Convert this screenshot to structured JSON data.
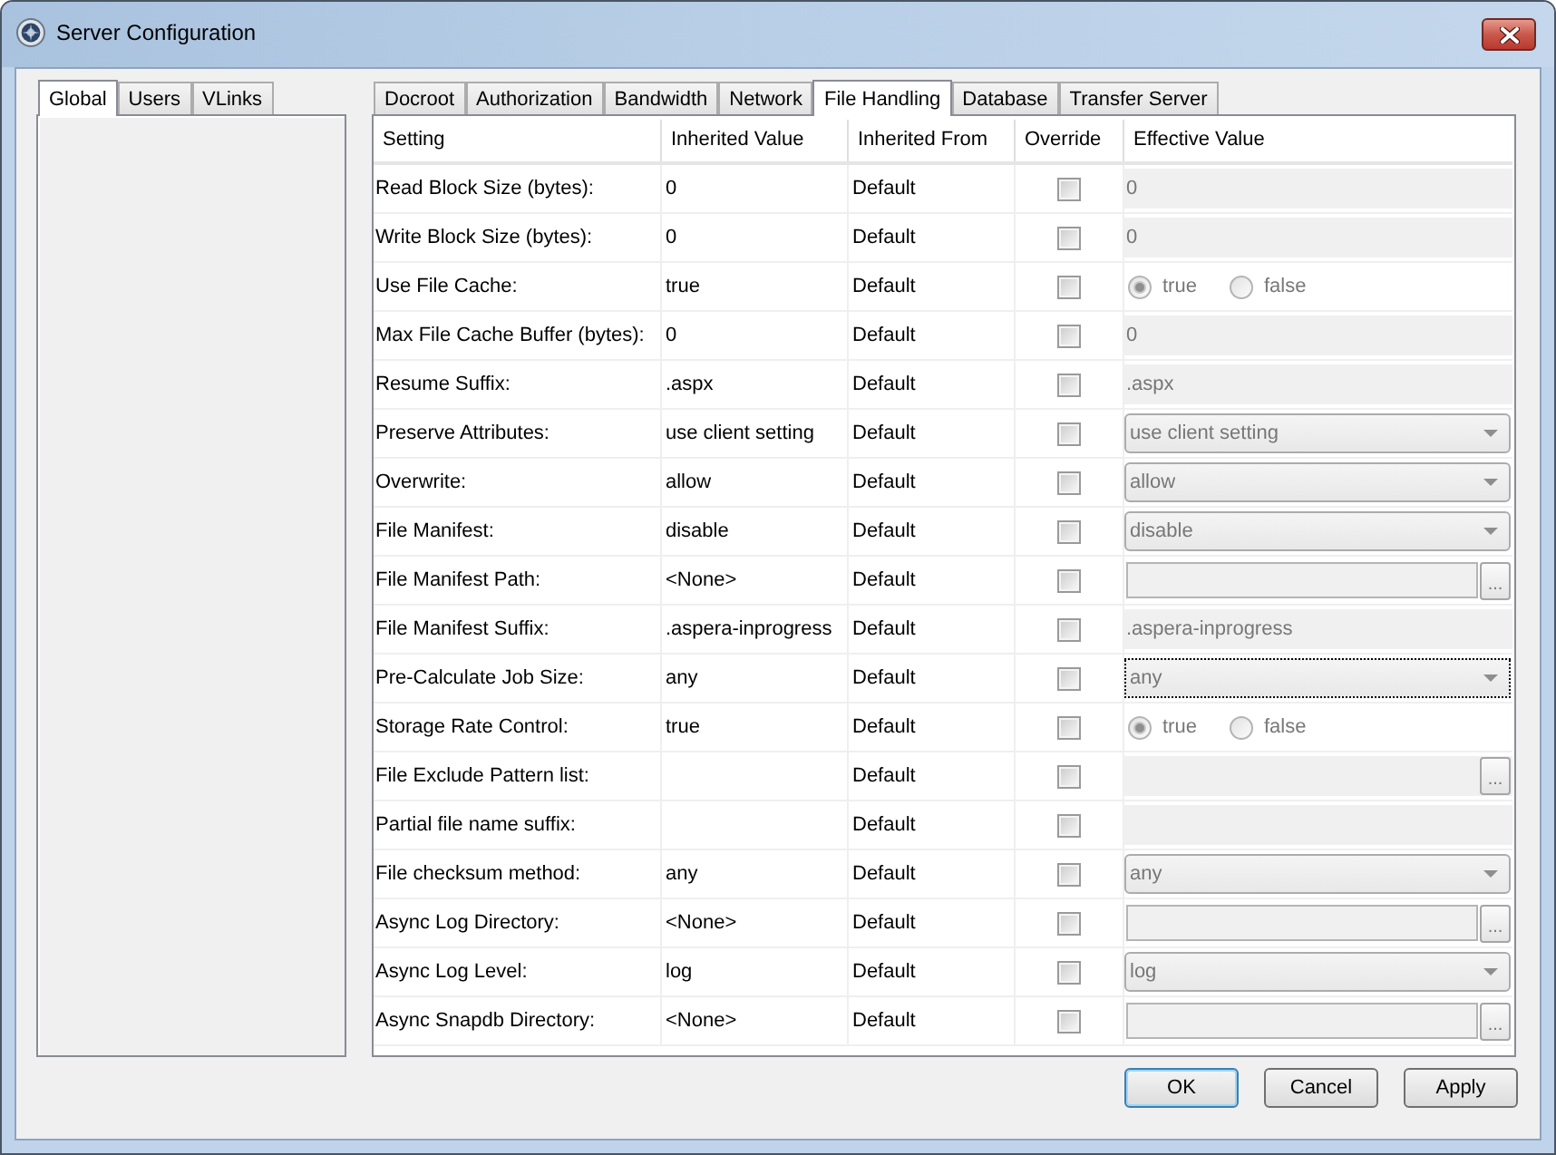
{
  "window": {
    "title": "Server Configuration"
  },
  "left_panel": {
    "tabs": [
      {
        "label": "Global",
        "selected": true
      },
      {
        "label": "Users",
        "selected": false
      },
      {
        "label": "VLinks",
        "selected": false
      }
    ]
  },
  "right_panel": {
    "tabs": [
      {
        "label": "Docroot",
        "selected": false
      },
      {
        "label": "Authorization",
        "selected": false
      },
      {
        "label": "Bandwidth",
        "selected": false
      },
      {
        "label": "Network",
        "selected": false
      },
      {
        "label": "File Handling",
        "selected": true
      },
      {
        "label": "Database",
        "selected": false
      },
      {
        "label": "Transfer Server",
        "selected": false
      }
    ],
    "table": {
      "columns": [
        "Setting",
        "Inherited Value",
        "Inherited From",
        "Override",
        "Effective Value"
      ],
      "rows": [
        {
          "setting": "Read Block Size (bytes):",
          "inherited_value": "0",
          "inherited_from": "Default",
          "override_checked": false,
          "effective": {
            "kind": "text",
            "value": "0",
            "focused": false
          }
        },
        {
          "setting": "Write Block Size (bytes):",
          "inherited_value": "0",
          "inherited_from": "Default",
          "override_checked": false,
          "effective": {
            "kind": "text",
            "value": "0",
            "focused": false
          }
        },
        {
          "setting": "Use File Cache:",
          "inherited_value": "true",
          "inherited_from": "Default",
          "override_checked": false,
          "effective": {
            "kind": "radio",
            "focused": false,
            "options": [
              {
                "label": "true",
                "selected": true
              },
              {
                "label": "false",
                "selected": false
              }
            ]
          }
        },
        {
          "setting": "Max File Cache Buffer (bytes):",
          "inherited_value": "0",
          "inherited_from": "Default",
          "override_checked": false,
          "effective": {
            "kind": "text",
            "value": "0",
            "focused": false
          }
        },
        {
          "setting": "Resume Suffix:",
          "inherited_value": ".aspx",
          "inherited_from": "Default",
          "override_checked": false,
          "effective": {
            "kind": "text",
            "value": ".aspx",
            "focused": false
          }
        },
        {
          "setting": "Preserve Attributes:",
          "inherited_value": "use client setting",
          "inherited_from": "Default",
          "override_checked": false,
          "effective": {
            "kind": "select",
            "value": "use client setting",
            "focused": false
          }
        },
        {
          "setting": "Overwrite:",
          "inherited_value": "allow",
          "inherited_from": "Default",
          "override_checked": false,
          "effective": {
            "kind": "select",
            "value": "allow",
            "focused": false
          }
        },
        {
          "setting": "File Manifest:",
          "inherited_value": "disable",
          "inherited_from": "Default",
          "override_checked": false,
          "effective": {
            "kind": "select",
            "value": "disable",
            "focused": false
          }
        },
        {
          "setting": "File Manifest Path:",
          "inherited_value": "<None>",
          "inherited_from": "Default",
          "override_checked": false,
          "effective": {
            "kind": "path",
            "button": "...",
            "focused": false
          }
        },
        {
          "setting": "File Manifest Suffix:",
          "inherited_value": ".aspera-inprogress",
          "inherited_from": "Default",
          "override_checked": false,
          "effective": {
            "kind": "text",
            "value": ".aspera-inprogress",
            "focused": false
          }
        },
        {
          "setting": "Pre-Calculate Job Size:",
          "inherited_value": "any",
          "inherited_from": "Default",
          "override_checked": false,
          "effective": {
            "kind": "select",
            "value": "any",
            "focused": true
          }
        },
        {
          "setting": "Storage Rate Control:",
          "inherited_value": "true",
          "inherited_from": "Default",
          "override_checked": false,
          "effective": {
            "kind": "radio",
            "focused": false,
            "options": [
              {
                "label": "true",
                "selected": true
              },
              {
                "label": "false",
                "selected": false
              }
            ]
          }
        },
        {
          "setting": "File Exclude Pattern list:",
          "inherited_from": "Default",
          "override_checked": false,
          "effective": {
            "kind": "list",
            "button": "...",
            "focused": false
          }
        },
        {
          "setting": "Partial file name suffix:",
          "inherited_from": "Default",
          "override_checked": false,
          "effective": {
            "kind": "text",
            "focused": false
          }
        },
        {
          "setting": "File checksum method:",
          "inherited_value": "any",
          "inherited_from": "Default",
          "override_checked": false,
          "effective": {
            "kind": "select",
            "value": "any",
            "focused": false
          }
        },
        {
          "setting": "Async Log Directory:",
          "inherited_value": "<None>",
          "inherited_from": "Default",
          "override_checked": false,
          "effective": {
            "kind": "path",
            "button": "...",
            "focused": false
          }
        },
        {
          "setting": "Async Log Level:",
          "inherited_value": "log",
          "inherited_from": "Default",
          "override_checked": false,
          "effective": {
            "kind": "select",
            "value": "log",
            "focused": false
          }
        },
        {
          "setting": "Async Snapdb Directory:",
          "inherited_value": "<None>",
          "inherited_from": "Default",
          "override_checked": false,
          "effective": {
            "kind": "path",
            "button": "...",
            "focused": false
          }
        }
      ]
    }
  },
  "buttons": [
    {
      "label": "OK",
      "default": true
    },
    {
      "label": "Cancel",
      "default": false
    },
    {
      "label": "Apply",
      "default": false
    }
  ]
}
